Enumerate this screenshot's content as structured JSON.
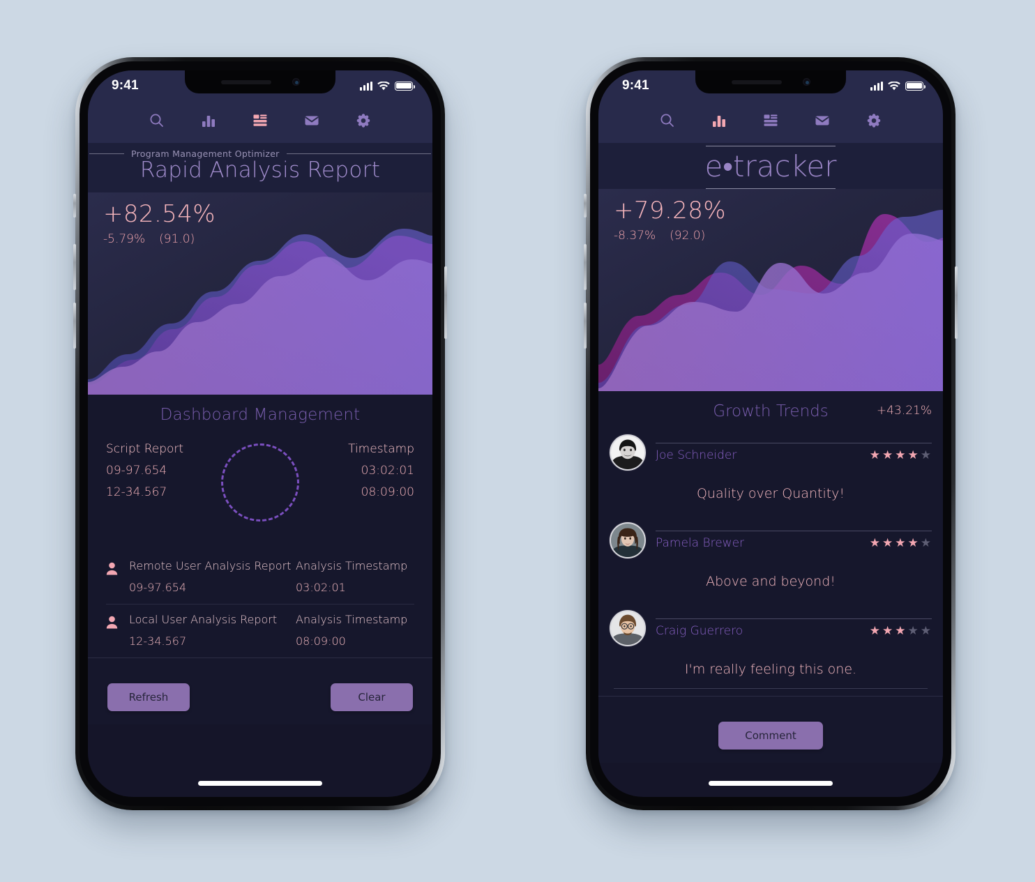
{
  "background_color": "#ccd8e4",
  "accent_purple": "#8a6fad",
  "accent_salmon": "#f3a7b2",
  "status_bar": {
    "time": "9:41",
    "signal_icon": "cellular-bars-icon",
    "wifi_icon": "wifi-icon",
    "battery_icon": "battery-icon"
  },
  "nav": {
    "items": [
      {
        "name": "search",
        "icon": "search-icon",
        "label": "Search"
      },
      {
        "name": "stats",
        "icon": "bar-chart-icon",
        "label": "Stats"
      },
      {
        "name": "feed",
        "icon": "list-article-icon",
        "label": "Feed"
      },
      {
        "name": "mail",
        "icon": "envelope-icon",
        "label": "Mail"
      },
      {
        "name": "settings",
        "icon": "gear-icon",
        "label": "Settings"
      }
    ],
    "left_active": "feed",
    "right_active": "stats"
  },
  "left_phone": {
    "kicker": "Program Management Optimizer",
    "title": "Rapid Analysis Report",
    "hero": {
      "big_percent": "+82.54%",
      "delta_percent": "-5.79%",
      "value": "(91.0)"
    },
    "section_title": "Dashboard Management",
    "summary": {
      "left_heading": "Script Report",
      "left_values": [
        "09-97.654",
        "12-34.567"
      ],
      "right_heading": "Timestamp",
      "right_values": [
        "03:02:01",
        "08:09:00"
      ],
      "ring_icon": "dashed-circle-progress-icon"
    },
    "rows": [
      {
        "icon": "person-icon",
        "label": "Remote User Analysis Report",
        "right_label": "Analysis Timestamp",
        "value": "09-97.654",
        "right_value": "03:02:01"
      },
      {
        "icon": "person-icon",
        "label": "Local User Analysis Report",
        "right_label": "Analysis Timestamp",
        "value": "12-34.567",
        "right_value": "08:09:00"
      }
    ],
    "buttons": {
      "primary": "Refresh",
      "secondary": "Clear"
    }
  },
  "right_phone": {
    "brand": "e•tracker",
    "hero": {
      "big_percent": "+79.28%",
      "delta_percent": "-8.37%",
      "value": "(92.0)"
    },
    "section_title": "Growth Trends",
    "section_percent": "+43.21%",
    "reviews": [
      {
        "name": "Joe Schneider",
        "rating": 4,
        "max_rating": 5,
        "text": "Quality over Quantity!",
        "avatar": "avatar-joe"
      },
      {
        "name": "Pamela Brewer",
        "rating": 4,
        "max_rating": 5,
        "text": "Above and beyond!",
        "avatar": "avatar-pamela"
      },
      {
        "name": "Craig Guerrero",
        "rating": 3,
        "max_rating": 5,
        "text": "I'm really feeling this one.",
        "avatar": "avatar-craig"
      }
    ],
    "buttons": {
      "primary": "Comment"
    }
  },
  "chart_data": [
    {
      "type": "area",
      "title": "Rapid Analysis Report",
      "id": "left-hero-chart",
      "xlabel": "",
      "ylabel": "",
      "ylim": [
        0,
        100
      ],
      "grid": false,
      "legend": "none",
      "annotations": [
        "+82.54%",
        "-5.79%",
        "(91.0)"
      ],
      "x": [
        0,
        1,
        2,
        3,
        4,
        5,
        6,
        7,
        8,
        9,
        10
      ],
      "series": [
        {
          "name": "layer-1-violet",
          "color": "#8e6ec8",
          "values": [
            14,
            24,
            22,
            40,
            38,
            56,
            54,
            72,
            70,
            86,
            84
          ]
        },
        {
          "name": "layer-2-magenta",
          "color": "#7b2a80",
          "values": [
            4,
            10,
            26,
            22,
            44,
            40,
            62,
            58,
            80,
            76,
            92
          ]
        },
        {
          "name": "layer-3-blue",
          "color": "#5a57b8",
          "values": [
            20,
            30,
            28,
            48,
            46,
            64,
            62,
            80,
            78,
            90,
            88
          ]
        }
      ]
    },
    {
      "type": "area",
      "title": "e•tracker",
      "id": "right-hero-chart",
      "xlabel": "",
      "ylabel": "",
      "ylim": [
        0,
        100
      ],
      "grid": false,
      "legend": "none",
      "annotations": [
        "+79.28%",
        "-8.37%",
        "(92.0)",
        "+43.21%"
      ],
      "x": [
        0,
        1,
        2,
        3,
        4,
        5,
        6,
        7,
        8,
        9,
        10
      ],
      "series": [
        {
          "name": "layer-1-violet",
          "color": "#8e6ec8",
          "values": [
            6,
            30,
            46,
            44,
            60,
            58,
            70,
            66,
            80,
            86,
            84
          ]
        },
        {
          "name": "layer-2-magenta",
          "color": "#7b2a80",
          "values": [
            16,
            38,
            34,
            52,
            48,
            66,
            62,
            88,
            84,
            78,
            74
          ]
        },
        {
          "name": "layer-3-blue",
          "color": "#5a57b8",
          "values": [
            10,
            26,
            42,
            40,
            58,
            62,
            74,
            70,
            84,
            92,
            90
          ]
        }
      ]
    }
  ]
}
